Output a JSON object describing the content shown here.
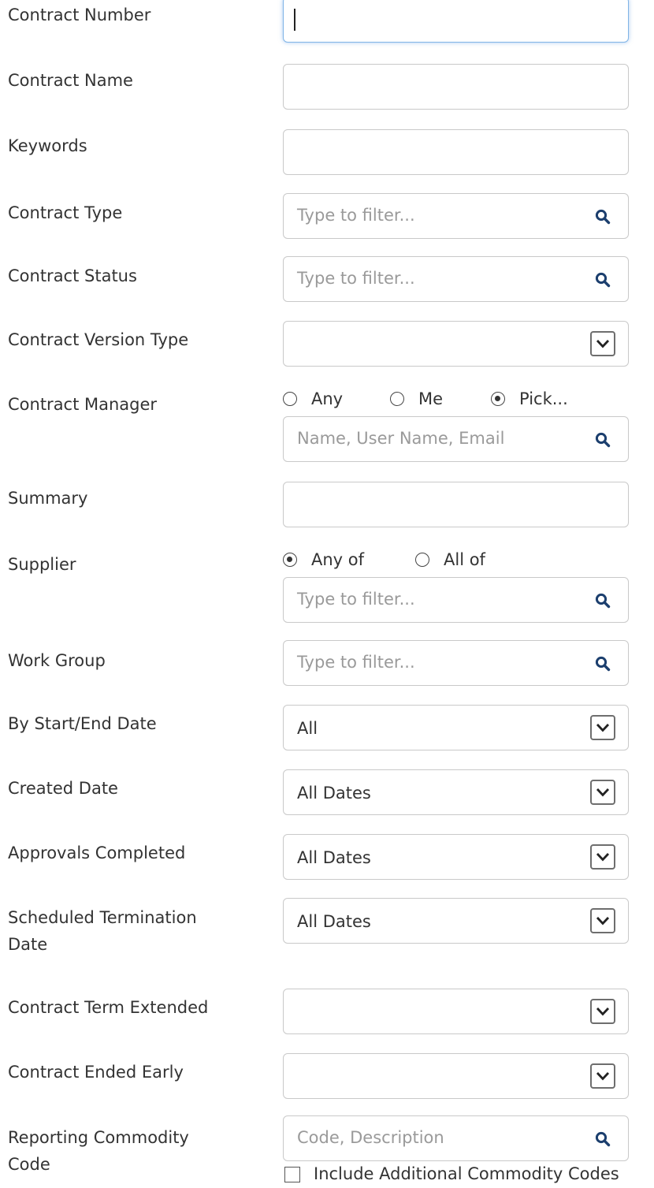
{
  "fields": {
    "contract_number": {
      "label": "Contract Number",
      "value": ""
    },
    "contract_name": {
      "label": "Contract Name",
      "value": ""
    },
    "keywords": {
      "label": "Keywords",
      "value": ""
    },
    "contract_type": {
      "label": "Contract Type",
      "placeholder": "Type to filter..."
    },
    "contract_status": {
      "label": "Contract Status",
      "placeholder": "Type to filter..."
    },
    "contract_version_type": {
      "label": "Contract Version Type",
      "value": ""
    },
    "contract_manager": {
      "label": "Contract Manager",
      "options": [
        "Any",
        "Me",
        "Pick..."
      ],
      "selected": "Pick...",
      "placeholder": "Name, User Name, Email"
    },
    "summary": {
      "label": "Summary",
      "value": ""
    },
    "supplier": {
      "label": "Supplier",
      "options": [
        "Any of",
        "All of"
      ],
      "selected": "Any of",
      "placeholder": "Type to filter..."
    },
    "work_group": {
      "label": "Work Group",
      "placeholder": "Type to filter..."
    },
    "by_start_end_date": {
      "label": "By Start/End Date",
      "value": "All"
    },
    "created_date": {
      "label": "Created Date",
      "value": "All Dates"
    },
    "approvals_completed": {
      "label": "Approvals Completed",
      "value": "All Dates"
    },
    "scheduled_termination_date": {
      "label_line1": "Scheduled Termination",
      "label_line2": "Date",
      "value": "All Dates"
    },
    "contract_term_extended": {
      "label": "Contract Term Extended",
      "value": ""
    },
    "contract_ended_early": {
      "label": "Contract Ended Early",
      "value": ""
    },
    "reporting_commodity_code": {
      "label_line1": "Reporting Commodity",
      "label_line2": "Code",
      "placeholder": "Code, Description",
      "checkbox_label": "Include Additional Commodity Codes",
      "checkbox_checked": false
    }
  },
  "icons": {
    "search": "search-icon",
    "dropdown": "chevron-down-icon"
  },
  "colors": {
    "search_icon": "#1c3f6e",
    "focus_border": "#80b4e6",
    "placeholder": "#9a9a9a"
  }
}
